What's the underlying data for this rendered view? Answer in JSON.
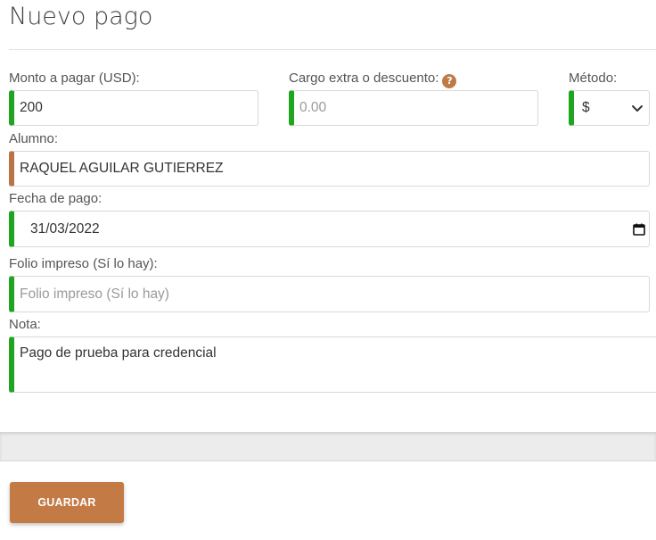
{
  "page": {
    "title": "Nuevo pago"
  },
  "form": {
    "amount": {
      "label": "Monto a pagar (USD):",
      "value": "200"
    },
    "extra": {
      "label": "Cargo extra o descuento:",
      "placeholder": "0.00",
      "help_icon": "question-circle-icon"
    },
    "method": {
      "label": "Método:",
      "selected": "$"
    },
    "student": {
      "label": "Alumno:",
      "value": "RAQUEL AGUILAR GUTIERREZ"
    },
    "date": {
      "label": "Fecha de pago:",
      "value": "31/03/2022"
    },
    "folio": {
      "label": "Folio impreso (Sí lo hay):",
      "placeholder": "Folio impreso (Sí lo hay)"
    },
    "note": {
      "label": "Nota:",
      "value": "Pago de prueba para credencial"
    }
  },
  "actions": {
    "save_label": "GUARDAR"
  },
  "colors": {
    "valid_accent": "#1fa51f",
    "student_accent": "#b87446",
    "primary_button": "#c47a45",
    "help_icon": "#c07a44"
  }
}
